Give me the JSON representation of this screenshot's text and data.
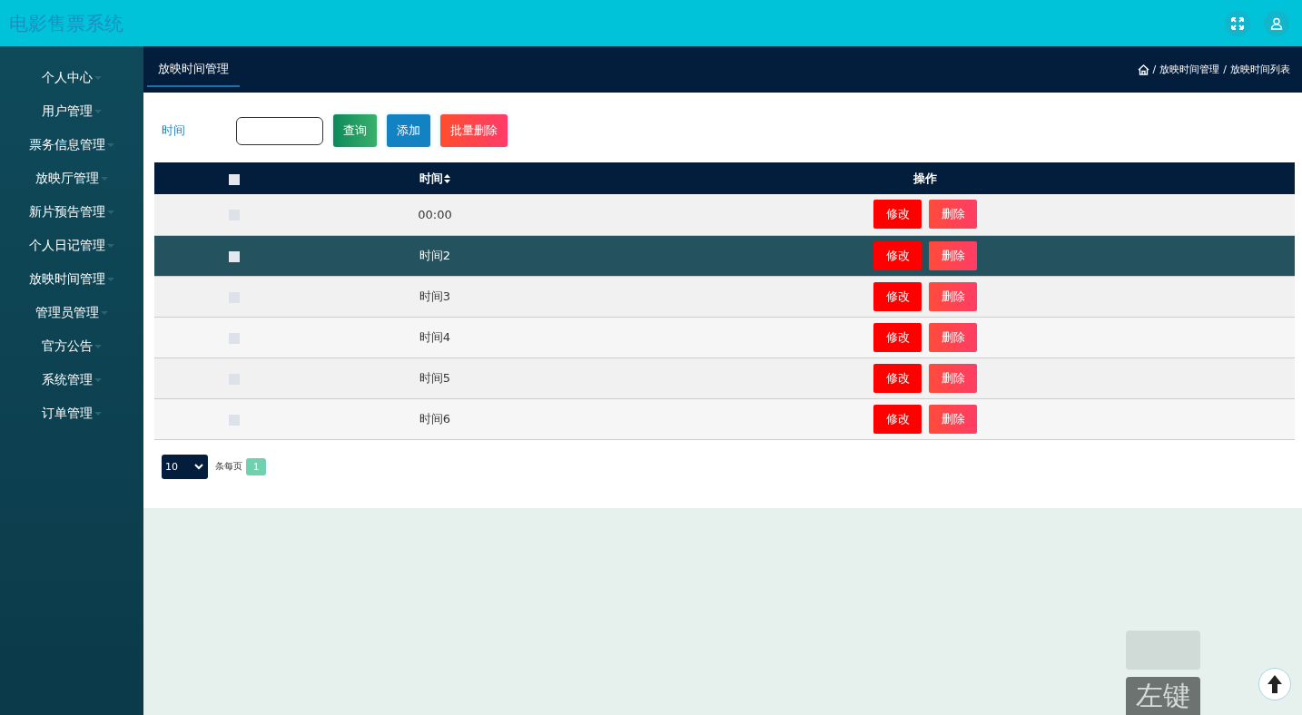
{
  "app_title": "电影售票系统",
  "sidebar": {
    "items": [
      {
        "label": "个人中心"
      },
      {
        "label": "用户管理"
      },
      {
        "label": "票务信息管理"
      },
      {
        "label": "放映厅管理"
      },
      {
        "label": "新片预告管理"
      },
      {
        "label": "个人日记管理"
      },
      {
        "label": "放映时间管理"
      },
      {
        "label": "管理员管理"
      },
      {
        "label": "官方公告"
      },
      {
        "label": "系统管理"
      },
      {
        "label": "订单管理"
      }
    ]
  },
  "tab": {
    "label": "放映时间管理",
    "selected": true
  },
  "breadcrumb": [
    {
      "separator": "/",
      "label": "放映时间管理"
    },
    {
      "separator": "/",
      "label": "放映时间列表"
    }
  ],
  "search": {
    "label": "时间",
    "buttons": [
      {
        "label": "查询",
        "kind": "search"
      },
      {
        "label": "添加",
        "kind": "add"
      },
      {
        "label": "批量删除",
        "kind": "delete"
      }
    ]
  },
  "table": {
    "columns": [
      "时间",
      "操作"
    ],
    "header_checked": false,
    "rows": [
      {
        "time": "00:00",
        "checked": false,
        "highlighted": false,
        "actions": [
          "修改",
          "删除"
        ]
      },
      {
        "time": "时间2",
        "checked": false,
        "highlighted": true,
        "actions": [
          "修改",
          "删除"
        ]
      },
      {
        "time": "时间3",
        "checked": false,
        "highlighted": false,
        "actions": [
          "修改",
          "删除"
        ]
      },
      {
        "time": "时间4",
        "checked": false,
        "highlighted": false,
        "actions": [
          "修改",
          "删除"
        ]
      },
      {
        "time": "时间5",
        "checked": false,
        "highlighted": false,
        "actions": [
          "修改",
          "删除"
        ]
      },
      {
        "time": "时间6",
        "checked": false,
        "highlighted": false,
        "actions": [
          "修改",
          "删除"
        ]
      }
    ]
  },
  "pagination": {
    "page_size": "10",
    "per_page_label": "条每页",
    "pages": [
      {
        "label": "1",
        "selected": true
      }
    ]
  },
  "key_overlay": "左键"
}
